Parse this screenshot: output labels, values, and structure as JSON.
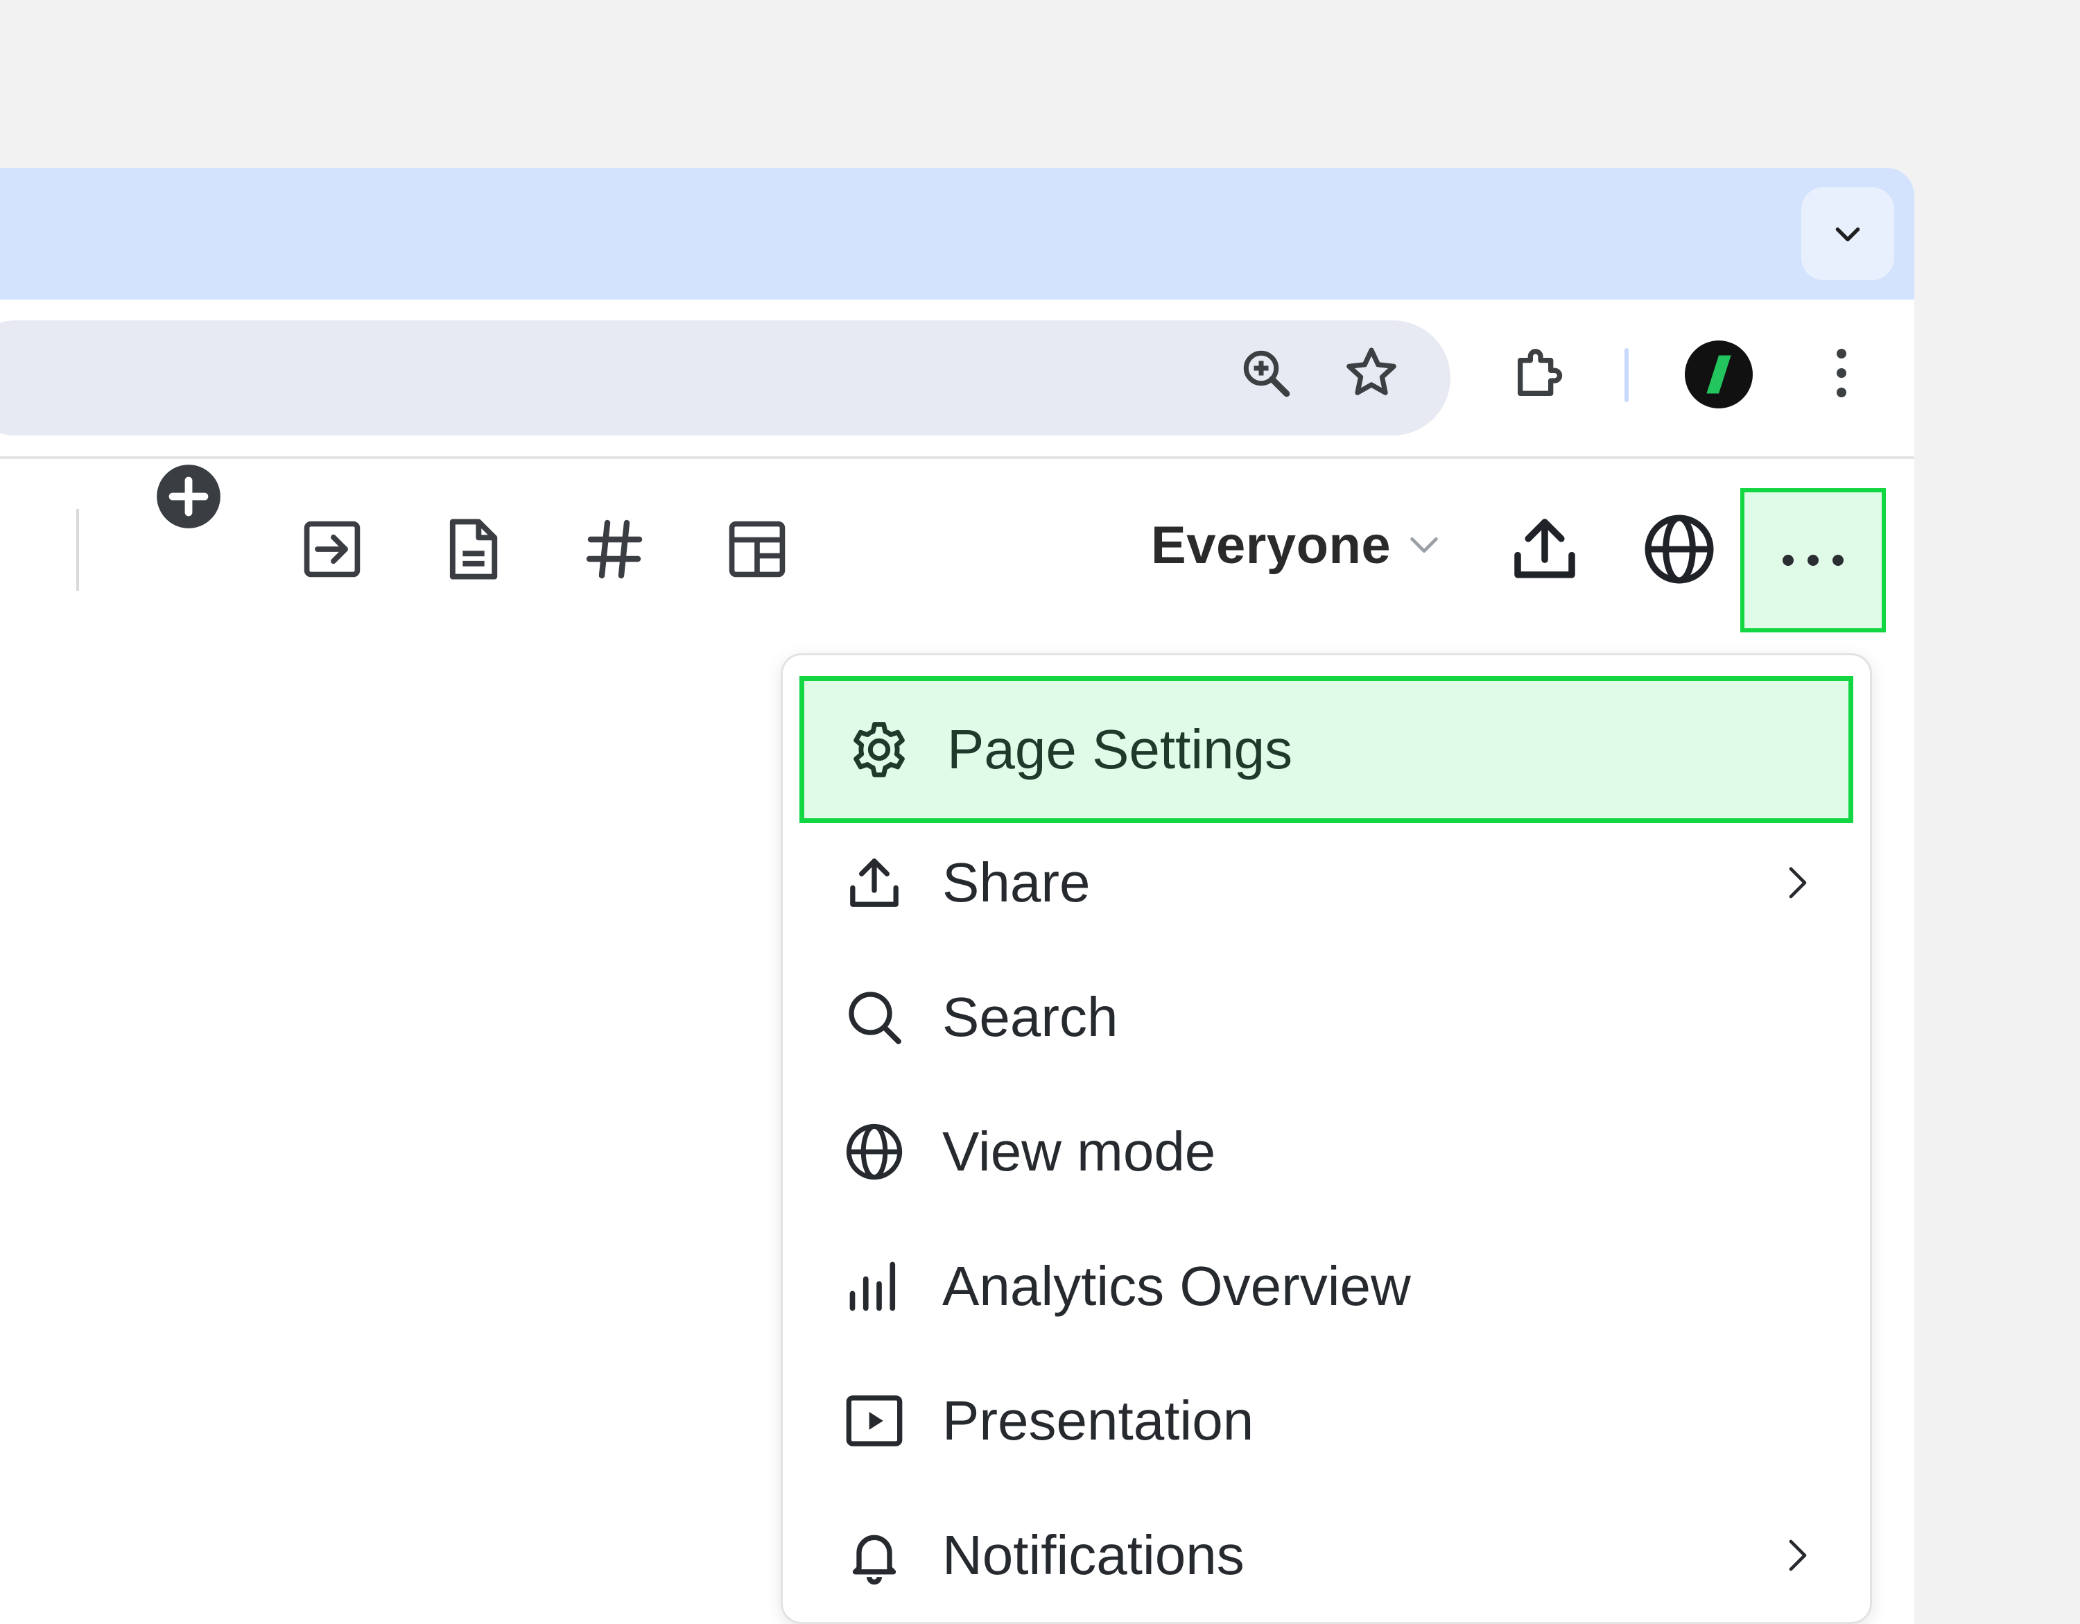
{
  "browser": {
    "icons": [
      "chevron-down-icon",
      "zoom-in-icon",
      "star-icon",
      "puzzle-icon",
      "avatar",
      "kebab-icon"
    ]
  },
  "toolbar": {
    "tools": [
      "add-circle-icon",
      "insert-arrow-icon",
      "document-icon",
      "hashtag-icon",
      "layout-icon"
    ],
    "audience_label": "Everyone",
    "share_icon": "upload-icon",
    "globe_icon": "globe-icon",
    "more_icon": "ellipsis-icon"
  },
  "menu": {
    "items": [
      {
        "label": "Page Settings",
        "icon": "gear-icon",
        "highlighted": true,
        "submenu": false
      },
      {
        "label": "Share",
        "icon": "upload-icon",
        "highlighted": false,
        "submenu": true
      },
      {
        "label": "Search",
        "icon": "search-icon",
        "highlighted": false,
        "submenu": false
      },
      {
        "label": "View mode",
        "icon": "globe-icon",
        "highlighted": false,
        "submenu": false
      },
      {
        "label": "Analytics Overview",
        "icon": "bar-chart-icon",
        "highlighted": false,
        "submenu": false
      },
      {
        "label": "Presentation",
        "icon": "play-icon",
        "highlighted": false,
        "submenu": false
      },
      {
        "label": "Notifications",
        "icon": "bell-icon",
        "highlighted": false,
        "submenu": true
      }
    ]
  },
  "colors": {
    "highlight_border": "#12d642",
    "highlight_fill": "#e1fbe9",
    "tabstrip": "#d3e3fd",
    "omnibox": "#e8eaf3",
    "icon": "#3c4043"
  }
}
